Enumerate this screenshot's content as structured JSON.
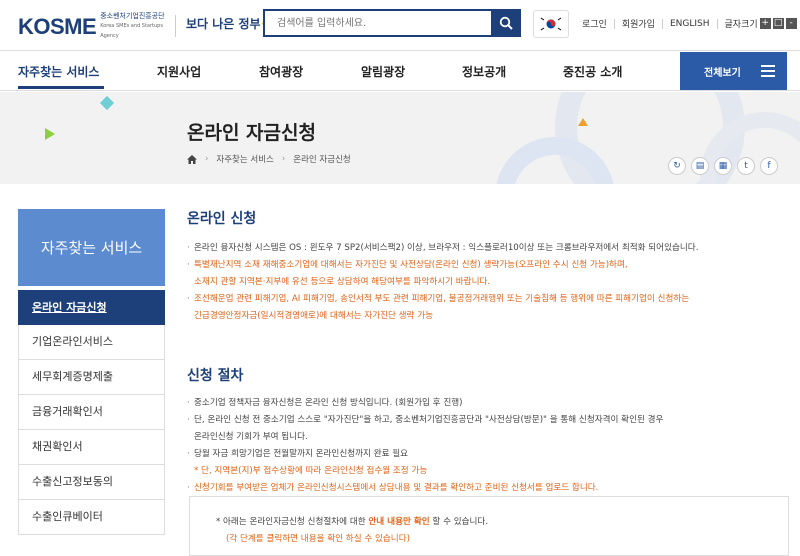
{
  "header": {
    "logo_text": "KOSME",
    "logo_sub_ko": "중소벤처기업진흥공단",
    "logo_sub_en": "Korea SMEs and Startups Agency",
    "slogan": "보다 나은 정부",
    "search_placeholder": "검색어를 입력하세요.",
    "utils": [
      "로그인",
      "회원가입",
      "ENGLISH",
      "글자크기"
    ],
    "font_buttons": [
      "+",
      "□",
      "-"
    ]
  },
  "nav": {
    "items": [
      "자주찾는 서비스",
      "지원사업",
      "참여광장",
      "알림광장",
      "정보공개",
      "중진공 소개"
    ],
    "all_view": "전체보기"
  },
  "banner": {
    "title": "온라인 자금신청",
    "breadcrumb": [
      "자주찾는 서비스",
      "온라인 자금신청"
    ],
    "share_icons": [
      "refresh-icon",
      "print-icon",
      "blog-icon",
      "twitter-icon",
      "facebook-icon"
    ]
  },
  "sidebar": {
    "heading": "자주찾는 서비스",
    "items": [
      "온라인 자금신청",
      "기업온라인서비스",
      "세무회계증명제출",
      "금융거래확인서",
      "채권확인서",
      "수출신고정보동의",
      "수출인큐베이터"
    ]
  },
  "section1": {
    "title": "온라인 신청",
    "items": [
      {
        "text": "온라인 융자신청 시스템은 OS : 윈도우 7 SP2(서비스팩2) 이상, 브라우저 : 익스플로러10이상 또는 크롬브라우저에서 최적화 되어있습니다.",
        "cont": ""
      },
      {
        "text": "특별재난지역 소재 재해중소기업에 대해서는 자가진단 및 사전상담(온라인 신청) 생략가능(오프라인 수시 신청 가능)하며,",
        "cont": "소재지 관할 지역본·지부에 유선 등으로 상담하여 해당여부를 파악하시기 바랍니다."
      },
      {
        "text": "조선해운업 관련 피해기업, AI 피해기업, 송인서적 부도 관련 피해기업, 불공정거래행위 또는 기술침해 등 행위에 따른 피해기업이 신청하는",
        "cont": "긴급경영안정자금(일시적경영애로)에 대해서는 자가진단 생략 가능"
      }
    ]
  },
  "section2": {
    "title": "신청 절차",
    "items": [
      {
        "text": "중소기업 정책자금 융자신청은 온라인 신청 방식입니다. (회원가입 후 진행)",
        "cont": ""
      },
      {
        "text": "단, 온라인 신청 전 중소기업 스스로 \"자가진단\"을 하고, 중소벤처기업진흥공단과 \"사전상담(방문)\" 을 통해 신청자격이 확인된 경우",
        "cont": "온라인신청 기회가 부여 됩니다."
      },
      {
        "text": "당월 자금 희망기업은 전월말까지 온라인신청까지 완료 필요",
        "cont": ""
      }
    ],
    "note": "* 단, 지역본(지)부 접수상황에 따라 온라인신청 접수월 조정 가능",
    "last": "신청기회를 부여받은 업체가 온라인신청시스템에서 상담내용 및 결과를 확인하고 준비된 신청서를 업로드 합니다."
  },
  "infobox": {
    "line1_pre": "* 아래는 온라인자금신청 신청절차에 대한 ",
    "line1_bold": "안내 내용만 확인",
    "line1_post": " 할 수 있습니다.",
    "line2": "(각 단계를 클릭하면 내용을 확인 하실 수 있습니다)"
  },
  "colors": {
    "primary": "#1d3f7a",
    "accent_blue": "#2b5aa6",
    "sidebar_head": "#5c8ccf",
    "orange": "#e06317"
  }
}
